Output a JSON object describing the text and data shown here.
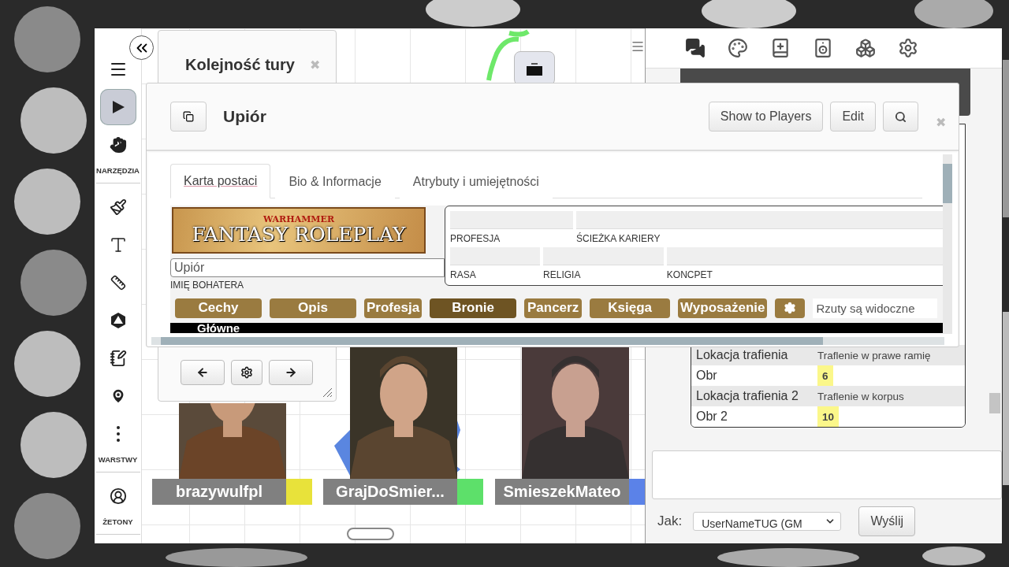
{
  "toolbar": {
    "groups": [
      {
        "tools": [
          {
            "selected": false
          },
          {
            "selected": true
          },
          {
            "selected": false
          }
        ],
        "label": "NARZĘDZIA"
      },
      {
        "tools": [
          {
            "selected": false
          },
          {
            "selected": false
          },
          {
            "selected": false
          },
          {
            "selected": false
          },
          {
            "selected": false
          },
          {
            "selected": false
          },
          {
            "selected": false
          }
        ],
        "label": "WARSTWY"
      },
      {
        "tools": [
          {
            "selected": false
          }
        ],
        "label": "ŻETONY"
      }
    ]
  },
  "turn_order": {
    "title": "Kolejność tury",
    "close": "✖"
  },
  "players": [
    {
      "name": "brazywulfpl",
      "color": "#e8e23a"
    },
    {
      "name": "GrajDoSmier...",
      "color": "#5de06a"
    },
    {
      "name": "SmieszekMateo",
      "color": "#5b82e8"
    }
  ],
  "sheet_dialog": {
    "title": "Upiór",
    "buttons": [
      "Show to Players",
      "Edit"
    ],
    "close": "✖",
    "tabs": [
      {
        "label": "Karta postaci",
        "selected": true
      },
      {
        "label": "Bio & Informacje",
        "selected": false
      },
      {
        "label": "Atrybuty i umiejętności",
        "selected": false
      }
    ],
    "logo": {
      "top": "WARHAMMER",
      "main": "FANTASY ROLEPLAY"
    },
    "name_field": {
      "value": "Upiór",
      "label": "IMIĘ BOHATERA"
    },
    "info_rows": [
      {
        "fields": [
          "PROFESJA",
          "ŚCIEŻKA KARIERY"
        ]
      },
      {
        "fields": [
          "RASA",
          "RELIGIA",
          "KONCPET"
        ]
      }
    ],
    "sections": [
      {
        "label": "Cechy",
        "selected": false
      },
      {
        "label": "Opis",
        "selected": false
      },
      {
        "label": "Profesja",
        "selected": false
      },
      {
        "label": "Bronie",
        "selected": true
      },
      {
        "label": "Pancerz",
        "selected": false
      },
      {
        "label": "Księga",
        "selected": false
      },
      {
        "label": "Wyposażenie",
        "selected": false
      }
    ],
    "rolls_field": {
      "value": "Rzuty są widoczne"
    },
    "section_bar": "Główne"
  },
  "chat": {
    "roll_rows": [
      {
        "kind": "text",
        "label": "Lokacja trafienia",
        "value": "Traflenie w prawe ramię"
      },
      {
        "kind": "number",
        "label": "Obr",
        "value": "6"
      },
      {
        "kind": "text",
        "label": "Lokacja trafienia 2",
        "value": "Traflenie w korpus"
      },
      {
        "kind": "number",
        "label": "Obr 2",
        "value": "10"
      }
    ],
    "speak_as": {
      "label": "Jak:",
      "value": "UserNameTUG (GM"
    },
    "send": "Wyślij"
  }
}
